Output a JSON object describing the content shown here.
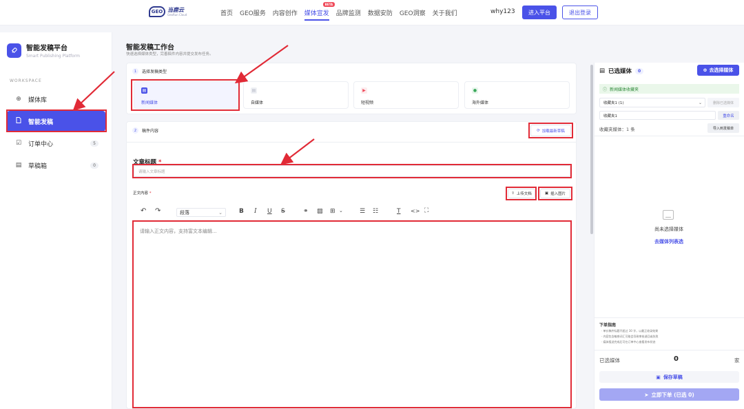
{
  "topnav": {
    "logo_mark": "GEO",
    "logo_text": "当鹿云",
    "logo_sub": "GeoRun Cloud",
    "links": [
      "首页",
      "GEO服务",
      "内容创作",
      "媒体宣发",
      "品牌监测",
      "数据安防",
      "GEO洞察",
      "关于我们"
    ],
    "active_link": "媒体宣发",
    "beta_badge": "BETA",
    "username": "why123",
    "enter_label": "进入平台",
    "logout_label": "退出登录"
  },
  "sidebar": {
    "brand_title": "智能发稿平台",
    "brand_sub": "Smart Publishing Platform",
    "section": "WORKSPACE",
    "items": [
      {
        "label": "媒体库",
        "icon": "globe-icon",
        "count": ""
      },
      {
        "label": "智能发稿",
        "icon": "document-icon",
        "count": ""
      },
      {
        "label": "订单中心",
        "icon": "checklist-icon",
        "count": "5"
      },
      {
        "label": "草稿箱",
        "icon": "archive-icon",
        "count": "0"
      }
    ]
  },
  "main": {
    "title": "智能发稿工作台",
    "subtitle": "快速选择媒体类型，完善稿件内容并提交发布任务。",
    "step1": {
      "num": "1",
      "label": "选择发稿类型"
    },
    "types": [
      {
        "label": "新闻媒体",
        "icon": "news-icon",
        "color": "#4a52e8"
      },
      {
        "label": "自媒体",
        "icon": "media-icon",
        "color": "#b5b8c4"
      },
      {
        "label": "短视频",
        "icon": "video-icon",
        "color": "#ef4a5a"
      },
      {
        "label": "海外媒体",
        "icon": "globe-icon",
        "color": "#3aa85a"
      }
    ],
    "step2": {
      "num": "2",
      "label": "稿件内容"
    },
    "load_draft": "加载最新草稿",
    "title_label": "文章标题",
    "title_placeholder": "请输入文章标题",
    "body_label": "正文内容",
    "upload_doc": "上传文档",
    "insert_image": "插入图片",
    "paragraph_select": "段落",
    "editor_placeholder": "请输入正文内容，支持富文本编辑..."
  },
  "right": {
    "title": "已选媒体",
    "count": "0",
    "go_select": "去选择媒体",
    "favorites_label": "新闻媒体收藏夹",
    "fav_select": "收藏夹1 (1)",
    "delete_fav": "删除已选媒体",
    "fav_name": "收藏夹1",
    "rename": "重命名",
    "fav_count_text": "收藏夹媒体：1 条",
    "import": "导入到发稿单",
    "empty_text": "尚未选择媒体",
    "empty_link": "去媒体列表选",
    "guide_title": "下单指南",
    "guide_items": [
      "· 单价稿件标题不超过 30 字，以最正收录效果",
      "· 内容包含敏感词汇可能会导致审核退回或失败",
      "· 媒体报送完成后可在订单中心查看发布状态"
    ],
    "sum_label": "已选媒体",
    "sum_value": "0",
    "sum_unit": "家",
    "save_draft": "保存草稿",
    "order_now": "立即下单 (已选 0)"
  }
}
